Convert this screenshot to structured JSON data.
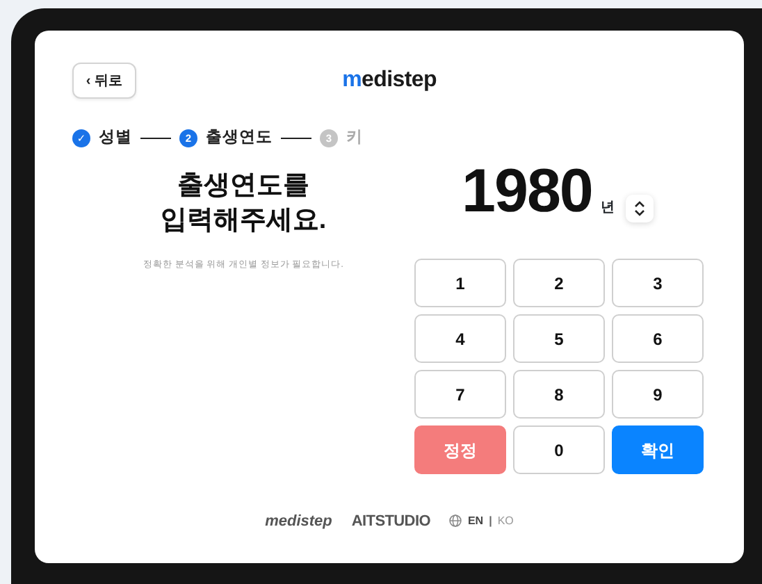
{
  "back_button": {
    "label": "뒤로",
    "icon": "‹"
  },
  "logo": "medistep",
  "steps": [
    {
      "marker": "✓",
      "label": "성별",
      "kind": "done"
    },
    {
      "marker": "2",
      "label": "출생연도",
      "kind": "current"
    },
    {
      "marker": "3",
      "label": "키",
      "kind": "pending"
    }
  ],
  "prompt": {
    "title_lines": [
      "출생연도를",
      "입력해주세요."
    ],
    "subtitle": "정확한 분석을 위해 개인별 정보가 필요합니다."
  },
  "year": {
    "value": "1980",
    "unit": "년"
  },
  "keypad": [
    {
      "label": "1",
      "kind": "digit"
    },
    {
      "label": "2",
      "kind": "digit"
    },
    {
      "label": "3",
      "kind": "digit"
    },
    {
      "label": "4",
      "kind": "digit"
    },
    {
      "label": "5",
      "kind": "digit"
    },
    {
      "label": "6",
      "kind": "digit"
    },
    {
      "label": "7",
      "kind": "digit"
    },
    {
      "label": "8",
      "kind": "digit"
    },
    {
      "label": "9",
      "kind": "digit"
    },
    {
      "label": "정정",
      "kind": "clear"
    },
    {
      "label": "0",
      "kind": "digit"
    },
    {
      "label": "확인",
      "kind": "confirm"
    }
  ],
  "footer": {
    "brand": "medistep",
    "studio": "AITSTUDIO",
    "separator": "|",
    "languages": [
      {
        "label": "EN",
        "selected": true
      },
      {
        "label": "KO",
        "selected": false
      }
    ]
  }
}
